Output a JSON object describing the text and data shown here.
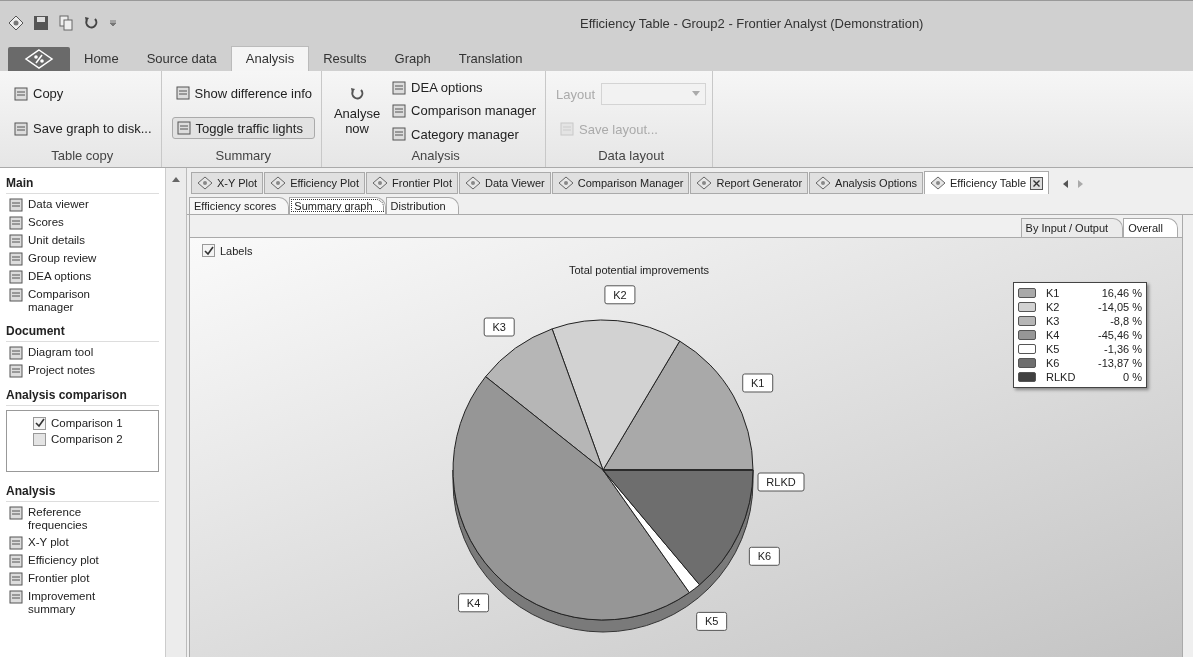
{
  "window": {
    "title": "Efficiency Table - Group2 - Frontier Analyst (Demonstration)"
  },
  "ribbon_tabs": [
    {
      "label": "Home",
      "selected": false
    },
    {
      "label": "Source data",
      "selected": false
    },
    {
      "label": "Analysis",
      "selected": true
    },
    {
      "label": "Results",
      "selected": false
    },
    {
      "label": "Graph",
      "selected": false
    },
    {
      "label": "Translation",
      "selected": false
    }
  ],
  "ribbon_groups": [
    {
      "label": "Table copy",
      "items": [
        {
          "kind": "small",
          "label": "Copy",
          "disabled": false
        },
        {
          "kind": "small",
          "label": "Save graph to disk...",
          "disabled": false
        }
      ]
    },
    {
      "label": "Summary",
      "items": [
        {
          "kind": "small",
          "label": "Show difference info",
          "disabled": false
        },
        {
          "kind": "toggle",
          "label": "Toggle traffic lights",
          "on": true,
          "disabled": false
        }
      ]
    },
    {
      "label": "Analysis",
      "items": [
        {
          "kind": "big",
          "label": "Analyse now",
          "disabled": false
        },
        {
          "kind": "small",
          "label": "DEA options",
          "disabled": false
        },
        {
          "kind": "small",
          "label": "Comparison manager",
          "disabled": false
        },
        {
          "kind": "small",
          "label": "Category manager",
          "disabled": false
        }
      ]
    },
    {
      "label": "Data layout",
      "items": [
        {
          "kind": "combo",
          "label": "Layout",
          "disabled": true
        },
        {
          "kind": "small",
          "label": "Save layout...",
          "disabled": true
        }
      ]
    }
  ],
  "sidebar": [
    {
      "title": "Main",
      "kind": "list",
      "items": [
        {
          "label": "Data viewer"
        },
        {
          "label": "Scores"
        },
        {
          "label": "Unit details"
        },
        {
          "label": "Group review"
        },
        {
          "label": "DEA options"
        },
        {
          "label": "Comparison manager"
        }
      ]
    },
    {
      "title": "Document",
      "kind": "list",
      "items": [
        {
          "label": "Diagram tool"
        },
        {
          "label": "Project notes"
        }
      ]
    },
    {
      "title": "Analysis comparison",
      "kind": "checks",
      "items": [
        {
          "label": "Comparison 1",
          "checked": true
        },
        {
          "label": "Comparison 2",
          "checked": false
        }
      ]
    },
    {
      "title": "Analysis",
      "kind": "list",
      "items": [
        {
          "label": "Reference frequencies"
        },
        {
          "label": "X-Y plot"
        },
        {
          "label": "Efficiency plot"
        },
        {
          "label": "Frontier plot"
        },
        {
          "label": "Improvement summary"
        }
      ]
    }
  ],
  "doc_tabs": [
    {
      "label": "X-Y Plot",
      "selected": false
    },
    {
      "label": "Efficiency Plot",
      "selected": false
    },
    {
      "label": "Frontier Plot",
      "selected": false
    },
    {
      "label": "Data Viewer",
      "selected": false
    },
    {
      "label": "Comparison Manager",
      "selected": false
    },
    {
      "label": "Report Generator",
      "selected": false
    },
    {
      "label": "Analysis Options",
      "selected": false
    },
    {
      "label": "Efficiency Table",
      "selected": true
    }
  ],
  "sub_tabs": [
    {
      "label": "Efficiency scores",
      "selected": false
    },
    {
      "label": "Summary graph",
      "selected": true
    },
    {
      "label": "Distribution",
      "selected": false
    }
  ],
  "view_tabs": [
    {
      "label": "By Input / Output",
      "selected": false
    },
    {
      "label": "Overall",
      "selected": true
    }
  ],
  "labels_checkbox": {
    "label": "Labels",
    "checked": true
  },
  "legend": [
    {
      "label": "K1",
      "value": "16,46 %",
      "color": "#a9a9a9"
    },
    {
      "label": "K2",
      "value": "-14,05 %",
      "color": "#d2d2d2"
    },
    {
      "label": "K3",
      "value": "-8,8 %",
      "color": "#b6b6b6"
    },
    {
      "label": "K4",
      "value": "-45,46 %",
      "color": "#969696"
    },
    {
      "label": "K5",
      "value": "-1,36 %",
      "color": "#ffffff"
    },
    {
      "label": "K6",
      "value": "-13,87 %",
      "color": "#6e6e6e"
    },
    {
      "label": "RLKD",
      "value": "0 %",
      "color": "#404040"
    }
  ],
  "chart_data": {
    "type": "pie",
    "title": "Total potential improvements",
    "categories": [
      "K1",
      "K2",
      "K3",
      "K4",
      "K5",
      "K6",
      "RLKD"
    ],
    "values": [
      16.46,
      14.05,
      8.8,
      45.46,
      1.36,
      13.87,
      0
    ]
  }
}
